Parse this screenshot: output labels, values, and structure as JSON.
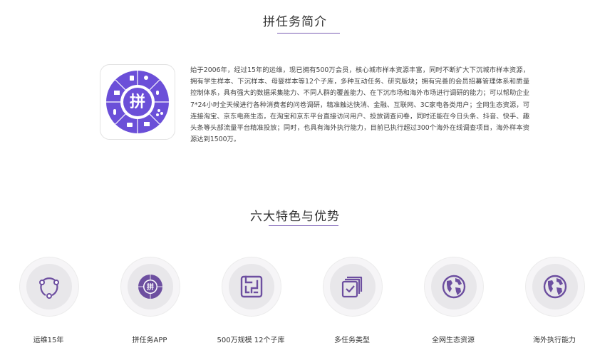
{
  "intro": {
    "title": "拼任务简介",
    "logo_icon": "pinrenwu-logo-icon",
    "logo_char": "拼",
    "accent_color": "#6b4fd8",
    "description": "始于2006年，经过15年的运维，现已拥有500万会员，核心城市样本资源丰富，同时不断扩大下沉城市样本资源，拥有学生样本、下沉样本、母婴样本等12个子库，多种互动任务、研究版块；拥有完善的会员招募管理体系和质量控制体系，具有强大的数据采集能力、不同人群的覆盖能力、在下沉市场和海外市场进行调研的能力；可以帮助企业7*24小时全天候进行各种消费者的问卷调研，精准触达快消、金融、互联网、3C家电各类用户；全网生态资源，可连接淘宝、京东电商生态，在淘宝和京东平台直接访问用户、投放调查问卷，同时还能在今日头条、抖音、快手、趣头条等头部流量平台精准投放；同时，也具有海外执行能力，目前已执行超过300个海外在线调查项目，海外样本资源达到1500万。"
  },
  "features": {
    "title": "六大特色与优势",
    "icon_color": "#6d4fa0",
    "items": [
      {
        "label": "运维15年",
        "icon": "cycle-icon"
      },
      {
        "label": "拼任务APP",
        "icon": "app-logo-icon",
        "char": "拼"
      },
      {
        "label": "500万规模 12个子库",
        "icon": "maze-icon"
      },
      {
        "label": "多任务类型",
        "icon": "task-stack-icon"
      },
      {
        "label": "全网生态资源",
        "icon": "globe-icon"
      },
      {
        "label": "海外执行能力",
        "icon": "globe-icon"
      }
    ]
  }
}
